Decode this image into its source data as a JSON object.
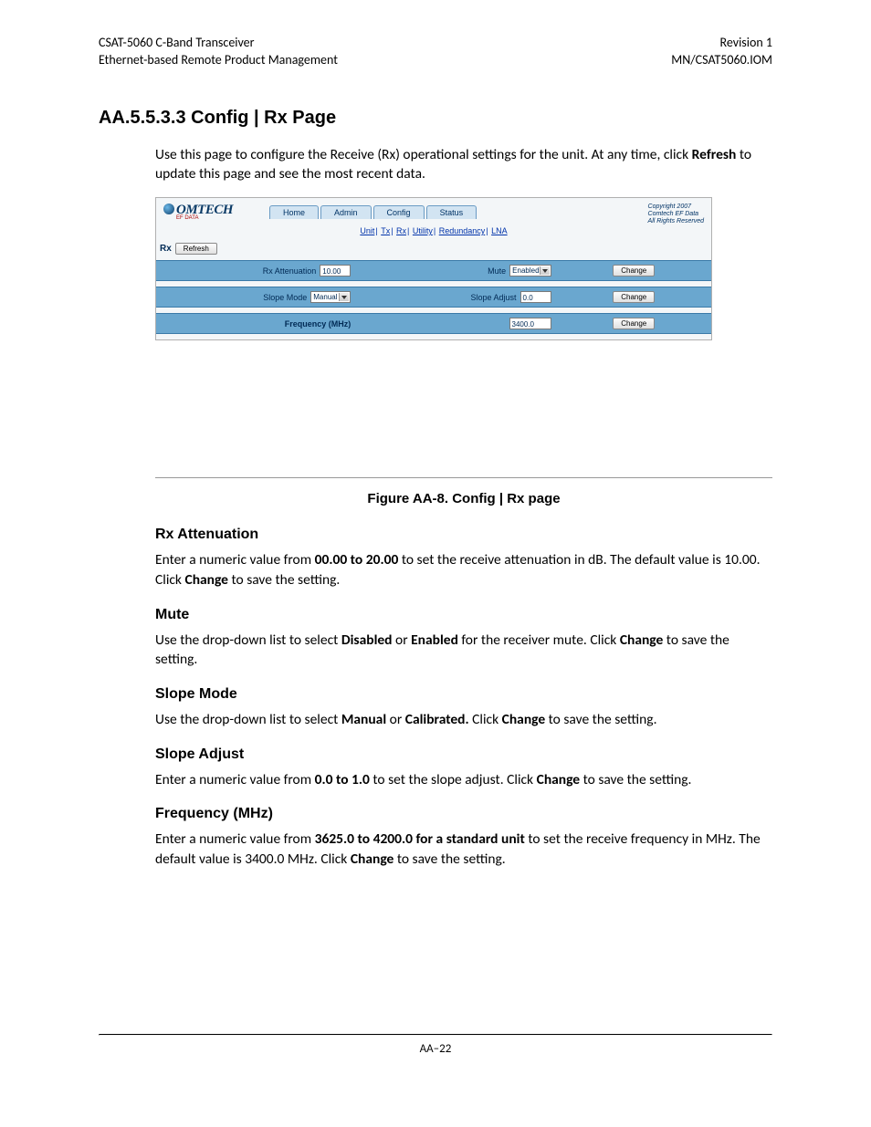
{
  "header": {
    "left1": "CSAT-5060 C-Band Transceiver",
    "left2": "Ethernet-based Remote Product Management",
    "right1": "Revision 1",
    "right2": "MN/CSAT5060.IOM"
  },
  "section_title": "AA.5.5.3.3   Config | Rx Page",
  "intro": {
    "part1": "Use this page to configure the Receive (Rx) operational settings for the unit. At any time, click ",
    "bold": "Refresh",
    "part2": " to update this page and see the most recent data."
  },
  "figure": {
    "caption": "Figure AA-8. Config | Rx page",
    "logo_text": "OMTECH",
    "logo_sub": "EF DATA",
    "tabs": [
      "Home",
      "Admin",
      "Config",
      "Status"
    ],
    "subtabs": [
      "Unit",
      "Tx",
      "Rx",
      "Utility",
      "Redundancy",
      "LNA"
    ],
    "copyright": [
      "Copyright 2007",
      "Comtech EF Data",
      "All Rights Reserved"
    ],
    "rx_label": "Rx",
    "refresh_btn": "Refresh",
    "change_btn": "Change",
    "row1": {
      "atten_label": "Rx Attenuation",
      "atten_value": "10.00",
      "mute_label": "Mute",
      "mute_value": "Enabled"
    },
    "row2": {
      "slope_mode_label": "Slope Mode",
      "slope_mode_value": "Manual",
      "slope_adj_label": "Slope Adjust",
      "slope_adj_value": "0.0"
    },
    "row3": {
      "freq_label": "Frequency (MHz)",
      "freq_value": "3400.0"
    }
  },
  "sections": {
    "rx_atten": {
      "title": "Rx Attenuation",
      "t1": "Enter a numeric value from ",
      "b1": "00.00 to 20.00",
      "t2": " to set the receive attenuation in dB. The default value is 10.00. Click ",
      "b2": "Change",
      "t3": " to save the setting."
    },
    "mute": {
      "title": "Mute",
      "t1": "Use the drop-down list to select ",
      "b1": "Disabled",
      "t2": " or ",
      "b2": "Enabled",
      "t3": " for the receiver mute. Click ",
      "b3": "Change",
      "t4": " to save the setting."
    },
    "slope_mode": {
      "title": "Slope Mode",
      "t1": "Use the drop-down list to select ",
      "b1": "Manual",
      "t2": " or ",
      "b2": "Calibrated.",
      "t3": " Click ",
      "b3": "Change",
      "t4": " to save the setting."
    },
    "slope_adj": {
      "title": "Slope Adjust",
      "t1": "Enter a numeric value from ",
      "b1": "0.0 to 1.0",
      "t2": " to set the slope adjust. Click ",
      "b2": "Change",
      "t3": " to save the setting."
    },
    "freq": {
      "title": "Frequency (MHz)",
      "t1": "Enter a numeric value from ",
      "b1": "3625.0 to 4200.0 for a standard unit",
      "t2": " to set the receive frequency in MHz. The default value is 3400.0 MHz. Click ",
      "b2": "Change",
      "t3": " to save the setting."
    }
  },
  "page_number": "AA–22"
}
